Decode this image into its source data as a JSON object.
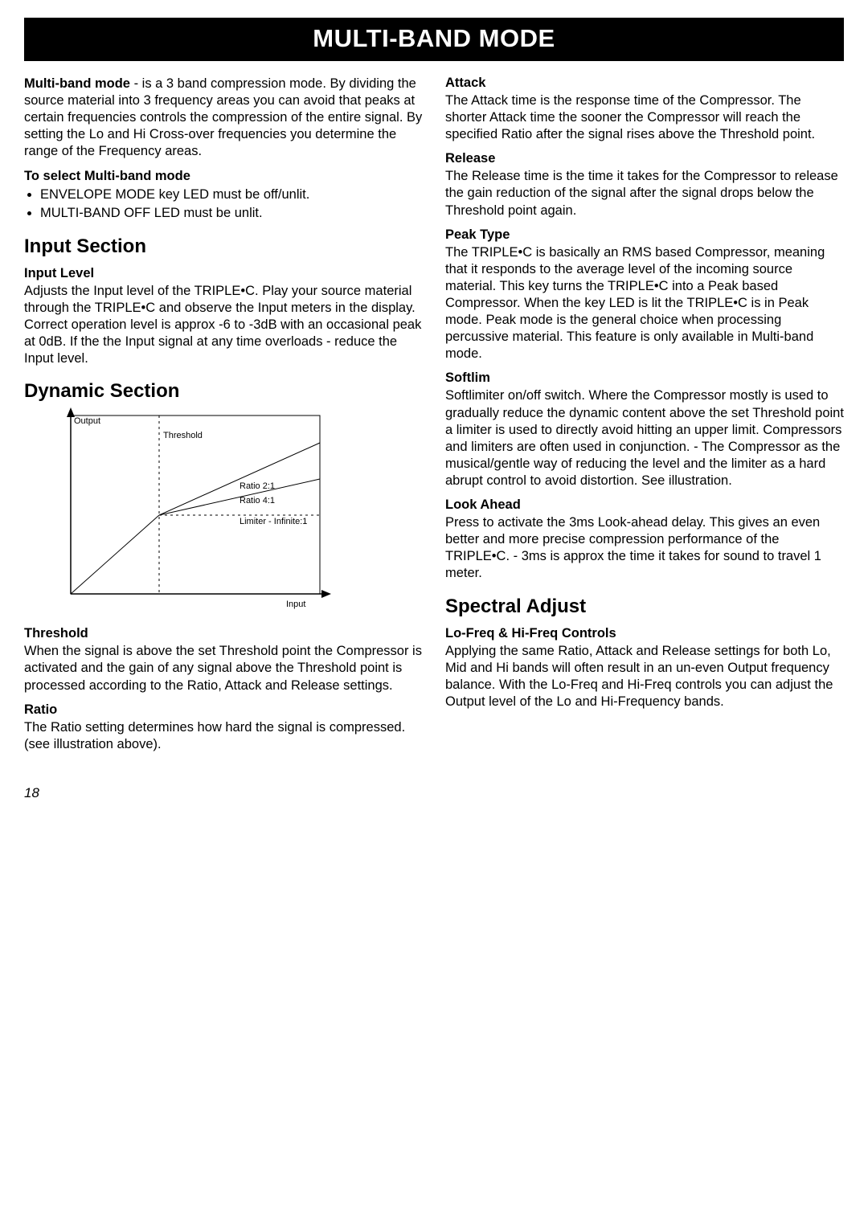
{
  "title": "MULTI-BAND MODE",
  "left": {
    "intro_bold": "Multi-band mode",
    "intro_rest": " - is a 3 band compression mode. By dividing the source material into 3 frequency areas you can avoid that peaks at certain frequencies controls the compression of the entire signal. By setting the Lo and Hi Cross-over frequencies you determine the range of the Frequency areas.",
    "select_head": "To select Multi-band mode",
    "select_items": [
      "ENVELOPE MODE key LED must be off/unlit.",
      "MULTI-BAND OFF LED must be unlit."
    ],
    "input_h": "Input Section",
    "input_level_h": "Input Level",
    "input_level_p": "Adjusts the Input level of the TRIPLE•C. Play your source material through the TRIPLE•C and observe the Input meters in the display. Correct operation level is approx -6 to -3dB with an occasional peak at 0dB. If the the Input signal at any time overloads - reduce the Input level.",
    "dyn_h": "Dynamic Section",
    "diagram": {
      "y_label": "Output",
      "x_label": "Input",
      "threshold": "Threshold",
      "r2": "Ratio 2:1",
      "r4": "Ratio 4:1",
      "lim": "Limiter - Infinite:1"
    },
    "threshold_h": "Threshold",
    "threshold_p": "When the signal is above the set Threshold point the Compressor is activated and the gain of any signal above the Threshold point is processed according to the Ratio, Attack and Release settings.",
    "ratio_h": "Ratio",
    "ratio_p": "The Ratio setting determines how hard the signal is compressed. (see illustration above)."
  },
  "right": {
    "attack_h": "Attack",
    "attack_p": "The Attack time is the response time of the Compressor. The shorter Attack time the sooner the Compressor will reach the specified Ratio after the signal rises above the Threshold point.",
    "release_h": "Release",
    "release_p": "The Release time is the time it takes for the Compressor to release the gain reduction of the signal after the signal drops below the Threshold point again.",
    "peak_h": "Peak Type",
    "peak_p": "The TRIPLE•C is basically an RMS based Compressor, meaning that it responds to the average level of the incoming source material. This key turns the TRIPLE•C into a Peak based Compressor. When the key LED is lit the TRIPLE•C is in Peak mode. Peak mode is the general choice when processing percussive material. This feature is only available in Multi-band mode.",
    "soft_h": "Softlim",
    "soft_p": "Softlimiter on/off switch. Where the Compressor mostly is used to gradually reduce the dynamic content above the set Threshold point a limiter is used to directly avoid hitting an upper limit. Compressors and limiters are often used in conjunction. - The Compressor as the musical/gentle way of reducing the level and the limiter as a hard abrupt control to avoid distortion. See illustration.",
    "look_h": "Look Ahead",
    "look_p": "Press to activate the 3ms Look-ahead delay. This gives an even better and more precise compression performance of the TRIPLE•C. - 3ms is approx the time it takes for sound to travel 1 meter.",
    "spec_h": "Spectral Adjust",
    "lofreq_h": "Lo-Freq & Hi-Freq Controls",
    "lofreq_p": "Applying the same Ratio, Attack and Release settings for both Lo, Mid and Hi bands will often result in an un-even Output frequency balance. With the Lo-Freq and Hi-Freq controls you can adjust the Output level of the Lo and Hi-Frequency bands."
  },
  "pagenum": "18"
}
